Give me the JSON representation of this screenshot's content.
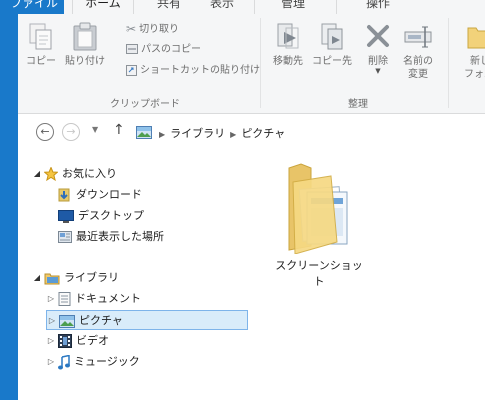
{
  "tabs": {
    "file": "ファイル",
    "home": "ホーム",
    "share": "共有",
    "view": "表示",
    "manage": "管理",
    "operations": "操作"
  },
  "ribbon": {
    "clipboard": {
      "copy": "コピー",
      "paste": "貼り付け",
      "cut": "切り取り",
      "copy_path": "パスのコピー",
      "paste_shortcut": "ショートカットの貼り付け",
      "group_label": "クリップボード"
    },
    "organize": {
      "move_to": "移動先",
      "copy_to": "コピー先",
      "delete": "削除",
      "rename_line1": "名前の",
      "rename_line2": "変更",
      "group_label": "整理"
    },
    "new": {
      "new_folder_line1": "新し",
      "new_folder_line2": "フォル"
    }
  },
  "address": {
    "path": [
      "ライブラリ",
      "ピクチャ"
    ]
  },
  "nav": {
    "favorites": {
      "label": "お気に入り",
      "items": [
        "ダウンロード",
        "デスクトップ",
        "最近表示した場所"
      ]
    },
    "libraries": {
      "label": "ライブラリ",
      "items": [
        "ドキュメント",
        "ピクチャ",
        "ビデオ",
        "ミュージック"
      ],
      "selected": "ピクチャ"
    }
  },
  "content": {
    "items": [
      {
        "name": "スクリーンショット",
        "type": "folder"
      }
    ]
  },
  "colors": {
    "accent": "#1979ca",
    "ribbon_bg": "#f5f6f7",
    "selection_bg": "#d9ecfa",
    "selection_border": "#7eb4ea"
  }
}
